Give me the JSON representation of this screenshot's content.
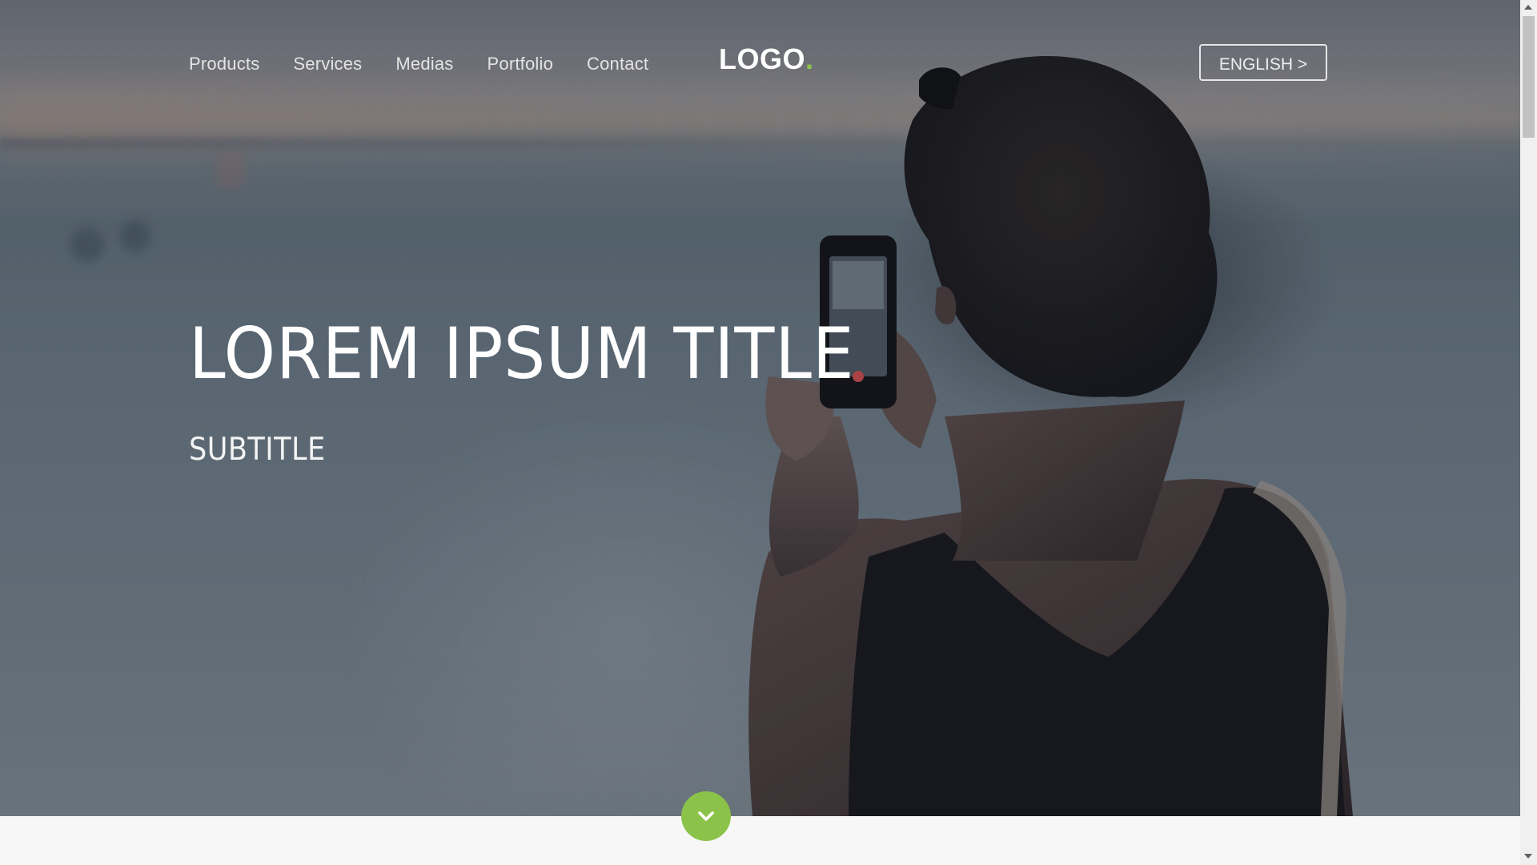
{
  "nav": {
    "items": [
      {
        "label": "Products"
      },
      {
        "label": "Services"
      },
      {
        "label": "Medias"
      },
      {
        "label": "Portfolio"
      },
      {
        "label": "Contact"
      }
    ]
  },
  "logo": {
    "text": "LOGO",
    "dot": "."
  },
  "language_button": {
    "label": "ENGLISH >"
  },
  "hero": {
    "title": "LOREM IPSUM TITLE",
    "subtitle": "SUBTITLE"
  },
  "scroll_down": {
    "icon": "chevron-down-icon"
  },
  "colors": {
    "accent": "#8bc34a",
    "nav_text": "#e3e3e3",
    "below_fold_bg": "#f7f7f7"
  }
}
